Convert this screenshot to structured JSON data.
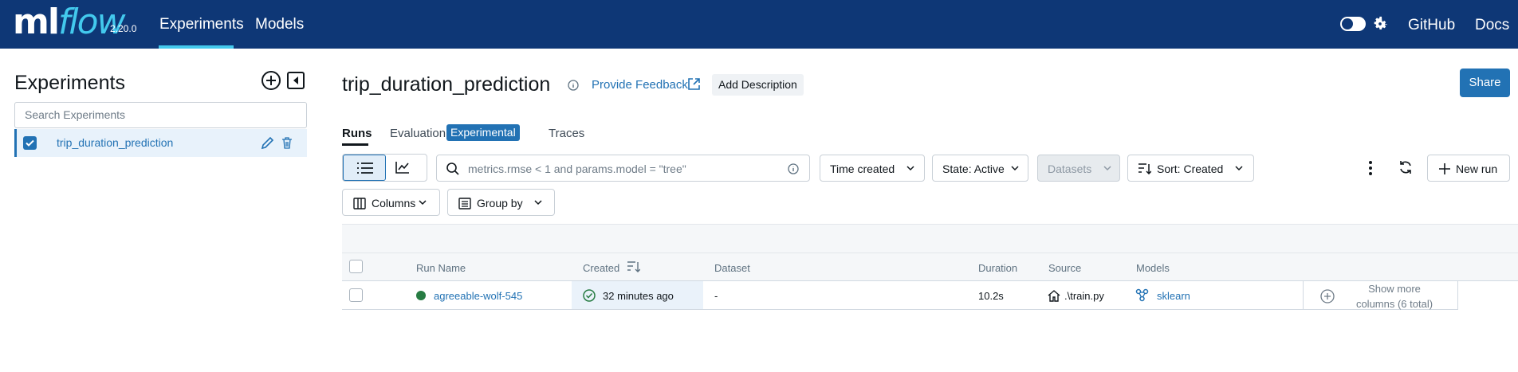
{
  "header": {
    "logo_ml": "ml",
    "logo_flow": "flow",
    "version": "2.20.0",
    "nav": [
      {
        "label": "Experiments"
      },
      {
        "label": "Models"
      }
    ],
    "github": "GitHub",
    "docs": "Docs"
  },
  "sidebar": {
    "title": "Experiments",
    "search_placeholder": "Search Experiments",
    "experiments": [
      {
        "name": "trip_duration_prediction",
        "checked": true
      }
    ]
  },
  "main": {
    "title": "trip_duration_prediction",
    "feedback_link": "Provide Feedback",
    "add_description": "Add Description",
    "share": "Share",
    "tabs": [
      {
        "label": "Runs"
      },
      {
        "label": "Evaluation"
      },
      {
        "label": "Traces"
      }
    ],
    "experimental_tag": "Experimental"
  },
  "toolbar": {
    "search_placeholder": "metrics.rmse < 1 and params.model = \"tree\"",
    "time_created": "Time created",
    "state": "State: Active",
    "datasets": "Datasets",
    "sort": "Sort: Created",
    "new_run": "New run",
    "columns": "Columns",
    "group_by": "Group by"
  },
  "table": {
    "headers": {
      "run_name": "Run Name",
      "created": "Created",
      "dataset": "Dataset",
      "duration": "Duration",
      "source": "Source",
      "models": "Models"
    },
    "rows": [
      {
        "run_name": "agreeable-wolf-545",
        "created": "32 minutes ago",
        "dataset": "-",
        "duration": "10.2s",
        "source": ".\\train.py",
        "model": "sklearn"
      }
    ],
    "show_more_line1": "Show more",
    "show_more_line2": "columns (6 total)"
  },
  "colors": {
    "header_bg": "#0e3776",
    "accent": "#2272b4",
    "logo_flow": "#43c9ed",
    "status_finished": "#277c43"
  }
}
